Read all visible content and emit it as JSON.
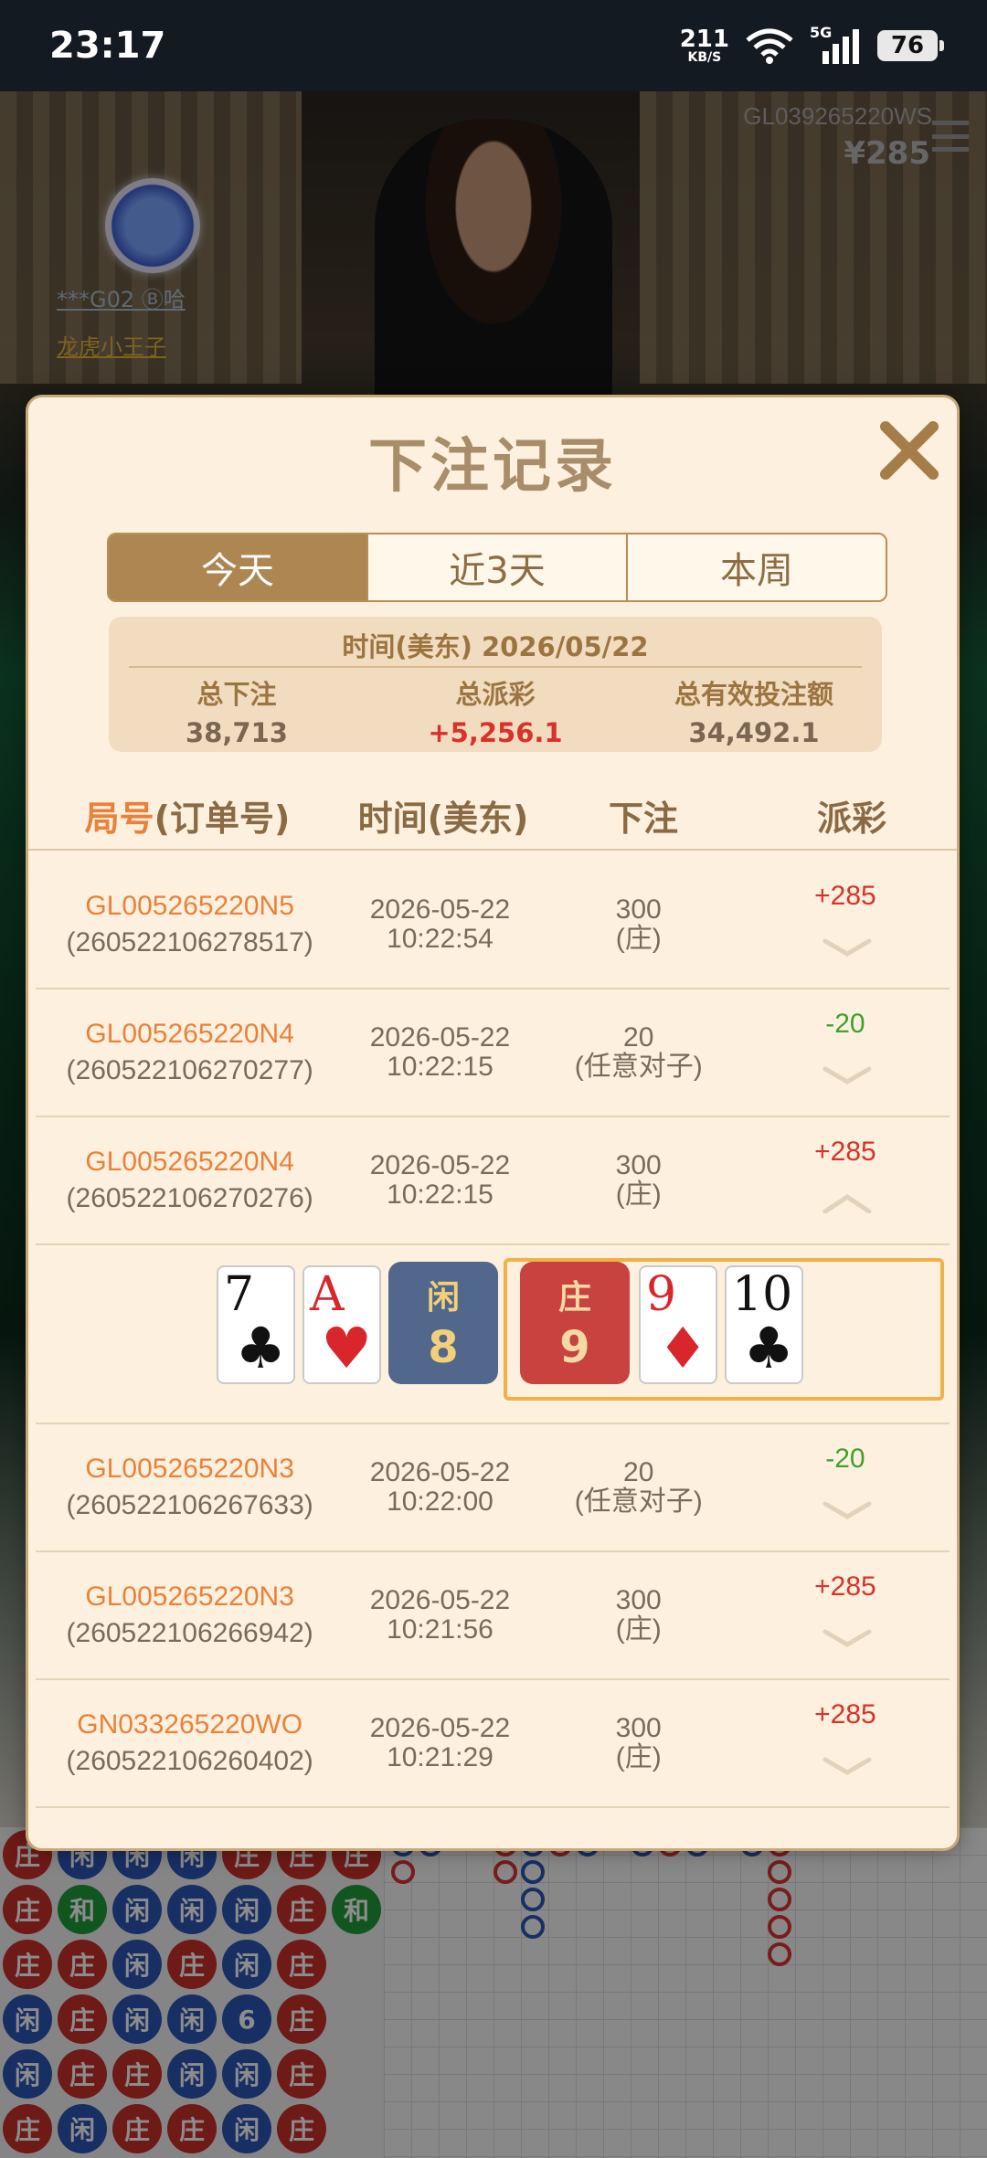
{
  "status": {
    "time": "23:17",
    "net_speed": "211",
    "net_unit": "KB/S",
    "network": "5G",
    "battery": "76"
  },
  "game": {
    "table_id": "GL039265220WS",
    "balance": "¥285",
    "player_name": "***G02 Ⓑ哈",
    "room_name": "龙虎小王子"
  },
  "modal": {
    "title": "下注记录",
    "tabs": [
      "今天",
      "近3天",
      "本周"
    ],
    "active_tab": 0,
    "summary": {
      "date_label": "时间(美东) 2026/05/22",
      "total_bet_label": "总下注",
      "total_bet": "38,713",
      "total_payout_label": "总派彩",
      "total_payout": "+5,256.1",
      "valid_bet_label": "总有效投注额",
      "valid_bet": "34,492.1"
    },
    "columns": {
      "round_prefix": "局号",
      "round_suffix": "(订单号)",
      "time": "时间(美东)",
      "bet": "下注",
      "payout": "派彩"
    },
    "records": [
      {
        "round": "GL005265220N5",
        "order": "(260522106278517)",
        "date": "2026-05-22",
        "clock": "10:22:54",
        "amount": "300",
        "type": "(庄)",
        "payout": "+285",
        "positive": true,
        "expanded": false
      },
      {
        "round": "GL005265220N4",
        "order": "(260522106270277)",
        "date": "2026-05-22",
        "clock": "10:22:15",
        "amount": "20",
        "type": "(任意对子)",
        "payout": "-20",
        "positive": false,
        "expanded": false
      },
      {
        "round": "GL005265220N4",
        "order": "(260522106270276)",
        "date": "2026-05-22",
        "clock": "10:22:15",
        "amount": "300",
        "type": "(庄)",
        "payout": "+285",
        "positive": true,
        "expanded": true
      },
      {
        "round": "GL005265220N3",
        "order": "(260522106267633)",
        "date": "2026-05-22",
        "clock": "10:22:00",
        "amount": "20",
        "type": "(任意对子)",
        "payout": "-20",
        "positive": false,
        "expanded": false
      },
      {
        "round": "GL005265220N3",
        "order": "(260522106266942)",
        "date": "2026-05-22",
        "clock": "10:21:56",
        "amount": "300",
        "type": "(庄)",
        "payout": "+285",
        "positive": true,
        "expanded": false
      },
      {
        "round": "GN033265220WO",
        "order": "(260522106260402)",
        "date": "2026-05-22",
        "clock": "10:21:29",
        "amount": "300",
        "type": "(庄)",
        "payout": "+285",
        "positive": true,
        "expanded": false
      }
    ],
    "detail": {
      "player_label": "闲",
      "player_score": "8",
      "banker_label": "庄",
      "banker_score": "9",
      "player_cards": [
        {
          "rank": "7",
          "suit": "♣"
        },
        {
          "rank": "A",
          "suit": "♥"
        }
      ],
      "banker_cards": [
        {
          "rank": "9",
          "suit": "♦"
        },
        {
          "rank": "10",
          "suit": "♣"
        }
      ]
    }
  },
  "roadmap": {
    "beads": [
      [
        "庄",
        "闲",
        "闲",
        "闲",
        "庄",
        "庄",
        "庄"
      ],
      [
        "庄",
        "和",
        "闲",
        "闲",
        "闲",
        "庄",
        "和"
      ],
      [
        "庄",
        "庄",
        "闲",
        "庄",
        "闲",
        "庄",
        ""
      ],
      [
        "闲",
        "庄",
        "闲",
        "闲",
        "6",
        "庄",
        ""
      ],
      [
        "闲",
        "庄",
        "庄",
        "闲",
        "闲",
        "庄",
        ""
      ],
      [
        "庄",
        "闲",
        "庄",
        "庄",
        "闲",
        "庄",
        ""
      ]
    ]
  },
  "colors": {
    "accent": "#ad8651",
    "modal_bg": "#fdf0de",
    "payout_positive": "#d8322b",
    "payout_negative": "#3fa22e",
    "round_id": "#e8823a"
  }
}
